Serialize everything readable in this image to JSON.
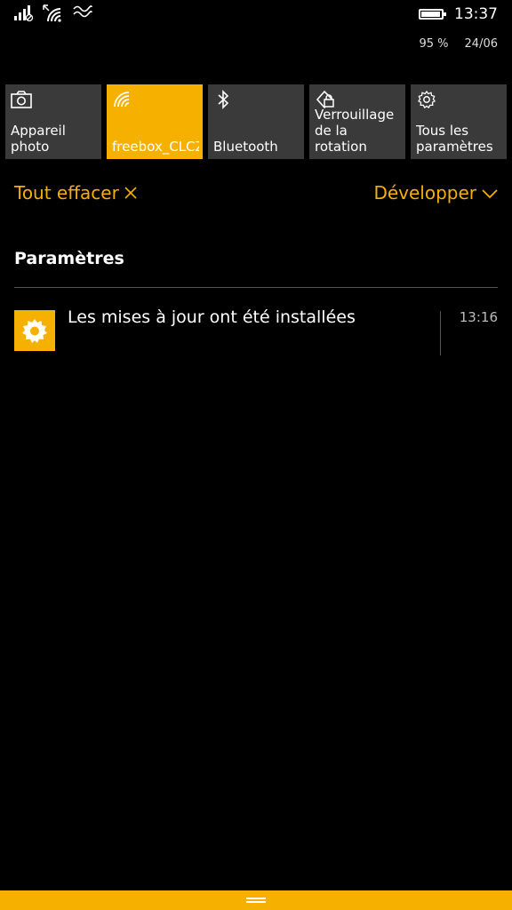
{
  "status_bar": {
    "time": "13:37",
    "battery_percent_label": "95 %",
    "battery_level": 0.95,
    "date": "24/06",
    "icons": [
      "signal-icon",
      "wifi-icon",
      "vibrate-icon"
    ]
  },
  "quick_actions": [
    {
      "icon": "camera-icon",
      "label": "Appareil\nphoto",
      "active": false
    },
    {
      "icon": "wifi-icon",
      "label": "freebox_CLCZ",
      "active": true
    },
    {
      "icon": "bluetooth-icon",
      "label": "Bluetooth",
      "active": false
    },
    {
      "icon": "rotation-lock-icon",
      "label": "Verrouillage\nde la rotation",
      "active": false
    },
    {
      "icon": "gear-icon",
      "label": "Tous les\nparamètres",
      "active": false
    }
  ],
  "actions": {
    "clear_all": "Tout effacer",
    "expand": "Développer"
  },
  "group": {
    "title": "Paramètres"
  },
  "notification": {
    "icon": "gear-icon",
    "text": "Les mises à jour ont été installées",
    "time": "13:16"
  },
  "colors": {
    "accent": "#f5b000",
    "background": "#000000",
    "tile": "#3a3a3a"
  }
}
